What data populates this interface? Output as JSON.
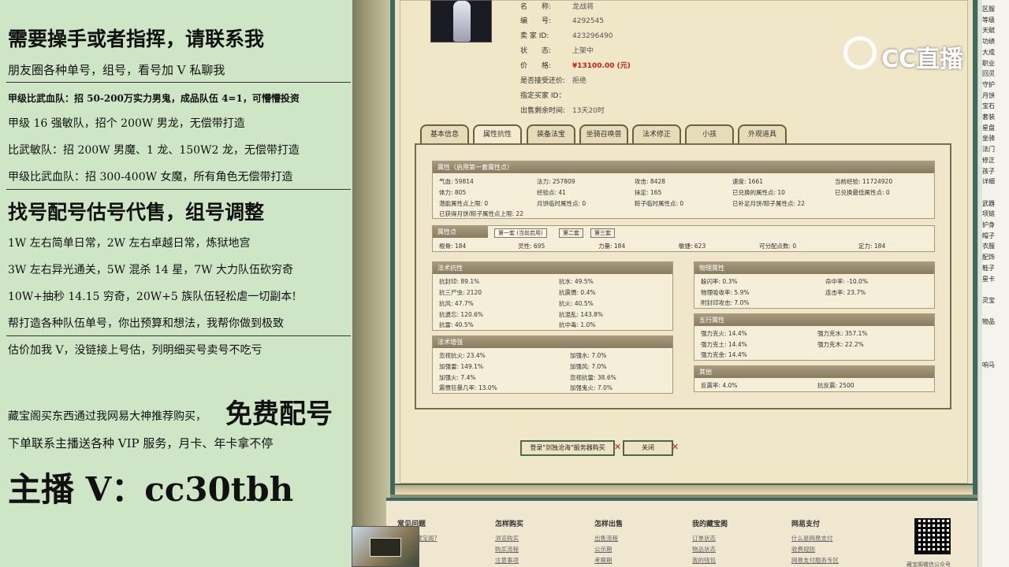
{
  "promo": {
    "l1": "需要操手或者指挥，请联系我",
    "l2": "朋友圈各种单号，组号，看号加 V 私聊我",
    "l3": "甲级比武血队：招 50-200万实力男鬼，成品队伍 4=1，可懵懵投资",
    "l4": "甲级 16 强敏队，招个 200W 男龙，无偿带打造",
    "l5": "比武敏队：招 200W 男魔、1 龙、150W2 龙，无偿带打造",
    "l6": "甲级比武血队：招 300-400W 女魔，所有角色无偿带打造",
    "l7": "找号配号估号代售，组号调整",
    "l8": "1W 左右简单日常，2W 左右卓越日常，炼狱地宫",
    "l9": "3W 左右异光通关，5W 混杀 14 星，7W 大力队伍砍穷奇",
    "l10": "10W+抽秒 14.15 穷奇，20W+5 族队伍轻松虐一切副本!",
    "l11": "帮打造各种队伍单号，你出预算和想法，我帮你做到极致",
    "l12": "估价加我 V，没链接上号估，列明细买号卖号不吃亏",
    "l13a": "藏宝阁买东西通过我网易大神推荐购买，",
    "l13b": "免费配号",
    "l14": "下单联系主播送各种 VIP 服务，月卡、年卡拿不停",
    "l15": "主播 V：cc30tbh"
  },
  "info": {
    "name_label": "名　　称:",
    "name": "龙战将",
    "id_label": "编　　号:",
    "id": "4292545",
    "seller_label": "卖 家 ID:",
    "seller": "423296490",
    "status_label": "状　　态:",
    "status": "上架中",
    "price_label": "价　　格:",
    "price": "¥13100.00 (元)",
    "bargain_label": "是否接受还价:",
    "bargain": "拒绝",
    "buyer_label": "指定买家 ID：",
    "buyer": "",
    "time_label": "出售剩余时间:",
    "time": "13天20时"
  },
  "tabs": [
    "基本信息",
    "属性抗性",
    "装备法宝",
    "坐骑召唤兽",
    "法术修正",
    "小孩",
    "外观道具"
  ],
  "attr": {
    "header": "属性（启用第一套属性点）",
    "rows": [
      [
        "气血: 59814",
        "法力: 257809",
        "攻击: 8428",
        "速度: 1661",
        "当前经验: 11724920"
      ],
      [
        "体力: 805",
        "经验点: 41",
        "抹定: 165",
        "已兑换的属性点: 10",
        "已兑换最低属性点: 0"
      ],
      [
        "潜能属性点上限: 0",
        "月饼临时属性点: 0",
        "粽子临时属性点: 0",
        "已补足月饼/粽子属性点: 22",
        ""
      ]
    ],
    "note": "已获得月饼/粽子属性点上限: 22"
  },
  "points": {
    "header": "属性点",
    "subtabs": [
      "第一套 (当前启用)",
      "第二套",
      "第三套"
    ],
    "cells": [
      "根骨: 184",
      "灵性: 695",
      "力量: 184",
      "敏捷: 623",
      "可分配点数: 0",
      "定力: 184"
    ]
  },
  "res": {
    "header": "法术抗性",
    "cells": [
      "抗封印: 89.1%",
      "抗水: 49.5%",
      "抗三尸虫: 2120",
      "抗震慑: 0.4%",
      "抗风: 47.7%",
      "抗火: 40.5%",
      "抗遗忘: 120.6%",
      "抗混乱: 143.8%",
      "抗雷: 40.5%",
      "抗中毒: 1.0%"
    ]
  },
  "boost": {
    "header": "法术增强",
    "cells": [
      "忽视抗火: 23.4%",
      "加强水: 7.0%",
      "加强雷: 149.1%",
      "加强风: 7.0%",
      "加强火: 7.4%",
      "忽视抗雷: 38.6%",
      "震慑狂暴几率: 13.0%",
      "加强鬼火: 7.0%"
    ]
  },
  "phys": {
    "header": "物理属性",
    "cells": [
      "躲闪率: 0.3%",
      "命中率: -10.0%",
      "物理吸收率: 5.9%",
      "连击率: 23.7%",
      "附封印攻击: 7.0%"
    ]
  },
  "five": {
    "header": "五行属性",
    "cells": [
      "强力克火: 14.4%",
      "强力克水: 357.1%",
      "强力克土: 14.4%",
      "强力克木: 22.2%",
      "强力克金: 14.4%"
    ]
  },
  "other": {
    "header": "其他",
    "cells": [
      "反震率: 4.0%",
      "抗反震: 2500"
    ]
  },
  "buttons": {
    "login": "登录\"剑独沧海\"服务器购买",
    "close": "关闭",
    "x": "✕"
  },
  "footer": {
    "cols": [
      "常见问题",
      "怎样购买",
      "怎样出售",
      "我的藏宝阁",
      "网易支付"
    ],
    "links": [
      [
        "藏宝阁?"
      ],
      [
        "浏览购买",
        "购买流程",
        "注意事项"
      ],
      [
        "出售流程",
        "公示期",
        "考察期"
      ],
      [
        "订单状态",
        "物品状态",
        "我的钱包"
      ],
      [
        "什么是网易支付",
        "收费规则",
        "网易支付服务专区"
      ]
    ],
    "qr_caption": "藏宝阁微信公众号"
  },
  "right": [
    "区服",
    "等级",
    "天赋",
    "功绩",
    "大成",
    "职业",
    "回灵",
    "守护",
    "月饼",
    "宝石",
    "套装",
    "星盘",
    "坐骑",
    "法门",
    "修正",
    "孩子",
    "详细",
    "",
    "武器",
    "项链",
    "护身",
    "帽子",
    "衣服",
    "配饰",
    "鞋子",
    "星卡",
    "",
    "灵宝",
    "",
    "物品",
    "",
    "",
    "",
    "响马"
  ],
  "logo": "CC直播"
}
